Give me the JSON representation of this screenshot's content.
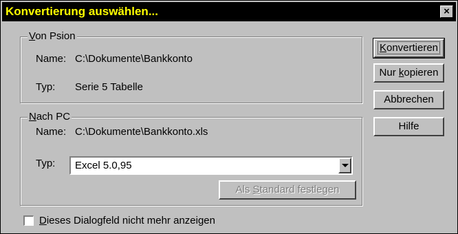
{
  "dialog": {
    "title": "Konvertierung auswählen...",
    "close_symbol": "×"
  },
  "from_group": {
    "title_mnemonic": "V",
    "title_rest": "on Psion",
    "name_label": "Name:",
    "name_value": "C:\\Dokumente\\Bankkonto",
    "type_label": "Typ:",
    "type_value": "Serie 5 Tabelle"
  },
  "to_group": {
    "title_mnemonic": "N",
    "title_rest": "ach PC",
    "name_label": "Name:",
    "name_value": "C:\\Dokumente\\Bankkonto.xls",
    "type_label": "Typ:",
    "type_select_value": "Excel 5.0,95",
    "default_button_pre": "Als ",
    "default_button_mnemonic": "S",
    "default_button_post": "tandard festlegen"
  },
  "buttons": {
    "convert_mnemonic": "K",
    "convert_rest": "onvertieren",
    "copy_pre": "Nur ",
    "copy_mnemonic": "k",
    "copy_post": "opieren",
    "cancel": "Abbrechen",
    "help": "Hilfe"
  },
  "checkbox": {
    "checked": false,
    "label_mnemonic": "D",
    "label_rest": "ieses Dialogfeld nicht mehr anzeigen"
  },
  "icons": {
    "close": "close-icon",
    "dropdown": "chevron-down-icon"
  }
}
